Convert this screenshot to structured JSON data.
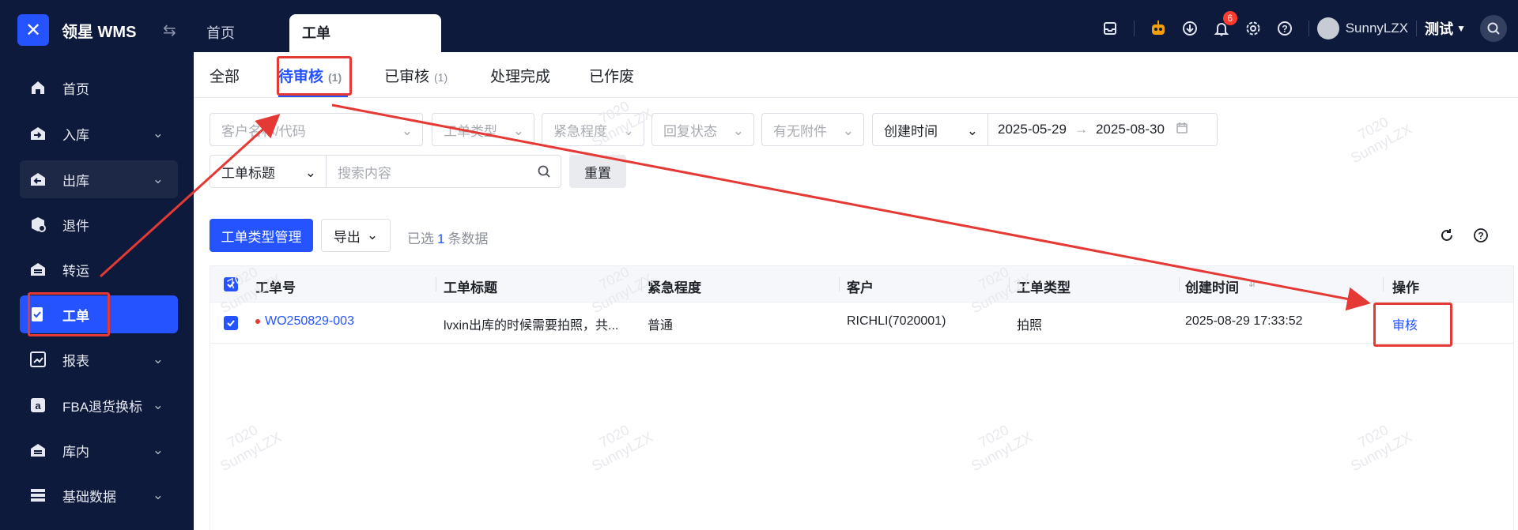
{
  "app": {
    "brand": "领星 WMS"
  },
  "top_tabs": [
    {
      "label": "首页"
    },
    {
      "label": "工单"
    }
  ],
  "header": {
    "notification_count": "6",
    "username": "SunnyLZX",
    "env_label": "测试"
  },
  "sidebar": {
    "items": [
      {
        "label": "首页"
      },
      {
        "label": "入库"
      },
      {
        "label": "出库"
      },
      {
        "label": "退件"
      },
      {
        "label": "转运"
      },
      {
        "label": "工单"
      },
      {
        "label": "报表"
      },
      {
        "label": "FBA退货换标"
      },
      {
        "label": "库内"
      },
      {
        "label": "基础数据"
      }
    ]
  },
  "status_tabs": [
    {
      "label": "全部",
      "count": ""
    },
    {
      "label": "待审核",
      "count": "(1)"
    },
    {
      "label": "已审核",
      "count": "(1)"
    },
    {
      "label": "处理完成",
      "count": ""
    },
    {
      "label": "已作废",
      "count": ""
    }
  ],
  "filters": {
    "customer_placeholder": "客户名称/代码",
    "type_placeholder": "工单类型",
    "urgency_placeholder": "紧急程度",
    "reply_placeholder": "回复状态",
    "attachment_placeholder": "有无附件",
    "time_field": "创建时间",
    "date_start": "2025-05-29",
    "date_end": "2025-08-30",
    "search_field": "工单标题",
    "search_placeholder": "搜索内容",
    "reset_label": "重置"
  },
  "toolbar": {
    "manage_label": "工单类型管理",
    "export_label": "导出",
    "selected_prefix": "已选",
    "selected_count": "1",
    "selected_suffix": "条数据"
  },
  "table": {
    "columns": [
      "工单号",
      "工单标题",
      "紧急程度",
      "客户",
      "工单类型",
      "创建时间",
      "操作"
    ],
    "rows": [
      {
        "order_no": "WO250829-003",
        "title": "lvxin出库的时候需要拍照，共...",
        "urgency": "普通",
        "customer": "RICHLI(7020001)",
        "type": "拍照",
        "created": "2025-08-29 17:33:52",
        "action": "审核"
      }
    ]
  },
  "watermark": {
    "line1": "7020",
    "line2": "SunnyLZX"
  },
  "colors": {
    "accent": "#2453ff",
    "sidebar_bg": "#0e1a3b",
    "annotation": "#e53935"
  }
}
